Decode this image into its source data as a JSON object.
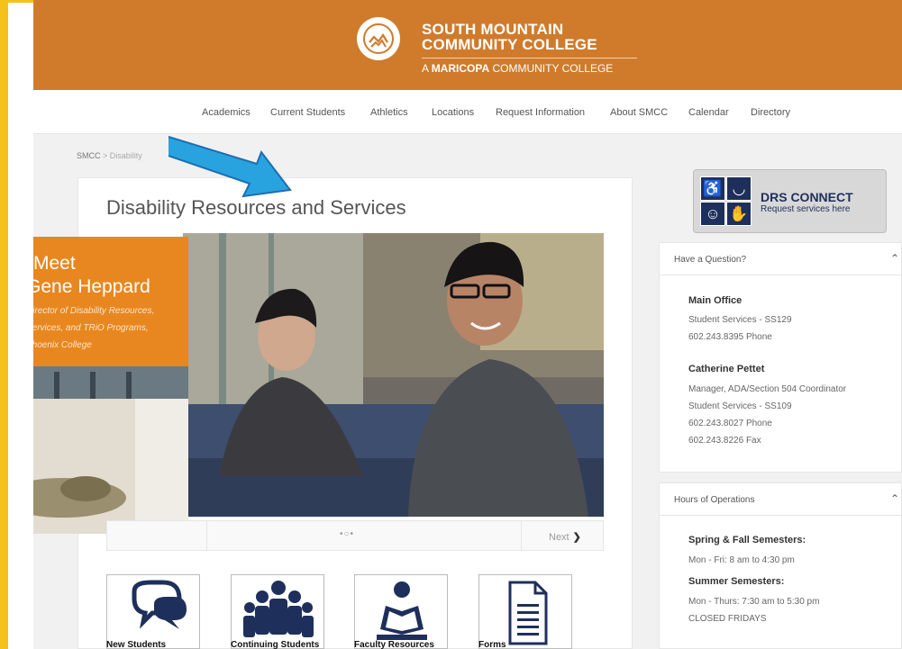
{
  "header": {
    "name_line1": "SOUTH MOUNTAIN",
    "name_line2": "COMMUNITY COLLEGE",
    "sub_prefix": "A",
    "sub_bold": "MARICOPA",
    "sub_suffix": "COMMUNITY COLLEGE",
    "logo_icon": "mountain-logo-icon"
  },
  "nav": {
    "items": [
      "Academics",
      "Current Students",
      "Athletics",
      "Locations",
      "Request Information",
      "About SMCC",
      "Calendar",
      "Directory"
    ]
  },
  "breadcrumb": {
    "home": "SMCC",
    "rest": "> Disability"
  },
  "main": {
    "title": "Disability Resources and Services",
    "slide": {
      "meet": "Meet",
      "name": "Gene Heppard",
      "role_line1": "Director of Disability Resources,",
      "role_line2": "Services, and TRiO Programs,",
      "role_line3": "Phoenix College"
    },
    "slider": {
      "dots": "•○•",
      "next": "Next",
      "next_icon": "chevron-right-icon"
    },
    "tiles": [
      {
        "label": "New Students",
        "icon": "speech-bubbles-icon"
      },
      {
        "label": "Continuing Students",
        "icon": "group-icon"
      },
      {
        "label": "Faculty Resources",
        "icon": "reader-icon"
      },
      {
        "label": "Forms",
        "icon": "document-icon"
      }
    ]
  },
  "drs": {
    "title": "DRS CONNECT",
    "subtitle": "Request services here"
  },
  "question_panel": {
    "title": "Have a Question?",
    "main_office": "Main Office",
    "office_location": "Student Services - SS129",
    "office_phone": "602.243.8395 Phone",
    "contact_name": "Catherine Pettet",
    "contact_role": "Manager, ADA/Section 504 Coordinator",
    "contact_location": "Student Services - SS109",
    "contact_phone": "602.243.8027 Phone",
    "contact_fax": "602.243.8226 Fax"
  },
  "hours_panel": {
    "title": "Hours of Operations",
    "spring_fall": "Spring & Fall Semesters:",
    "spring_fall_hours": "Mon - Fri: 8 am to 4:30 pm",
    "summer": "Summer Semesters:",
    "summer_hours": "Mon - Thurs: 7:30 am to 5:30 pm",
    "closed": "CLOSED FRIDAYS"
  },
  "colors": {
    "banner": "#d07b2b",
    "frame": "#f4c21b",
    "drs_navy": "#1e2f5c",
    "arrow": "#29a3e0"
  }
}
